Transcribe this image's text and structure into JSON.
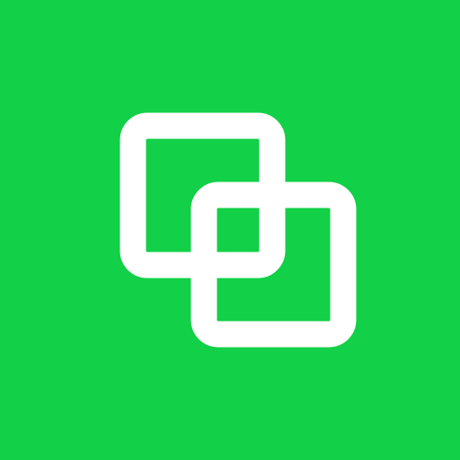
{
  "icon": {
    "name": "overlapping-squares-icon",
    "background_color": "#12d047",
    "stroke_color": "#ffffff"
  }
}
